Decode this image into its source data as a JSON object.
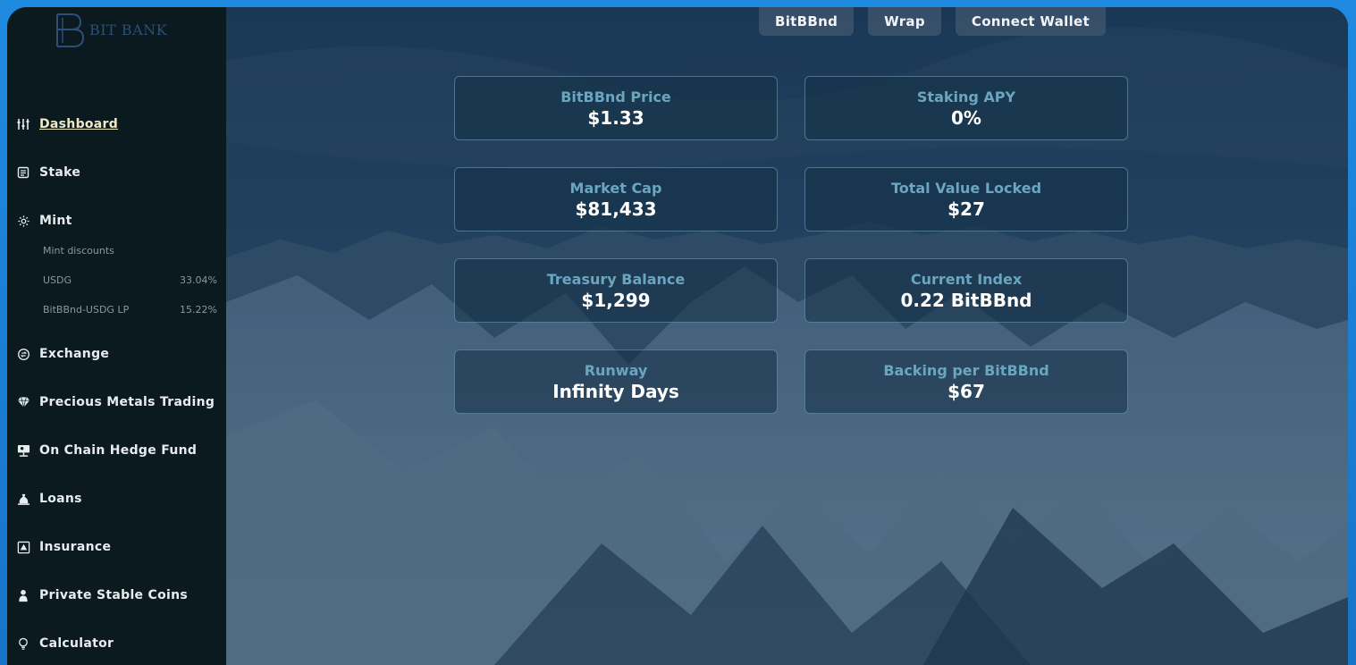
{
  "brand": {
    "logo_letter": "B",
    "logo_text": "BIT BANK"
  },
  "sidebar": {
    "items": [
      {
        "label": "Dashboard",
        "icon": "sliders-icon",
        "active": true
      },
      {
        "label": "Stake",
        "icon": "document-icon"
      },
      {
        "label": "Mint",
        "icon": "gear-icon"
      },
      {
        "label": "Exchange",
        "icon": "exchange-icon"
      },
      {
        "label": "Precious Metals Trading",
        "icon": "diamond-icon"
      },
      {
        "label": "On Chain Hedge Fund",
        "icon": "presentation-icon"
      },
      {
        "label": "Loans",
        "icon": "money-bag-icon"
      },
      {
        "label": "Insurance",
        "icon": "insurance-icon"
      },
      {
        "label": "Private Stable Coins",
        "icon": "person-icon"
      },
      {
        "label": "Calculator",
        "icon": "lightbulb-icon"
      }
    ],
    "mint_submenu": {
      "heading": "Mint discounts",
      "rows": [
        {
          "name": "USDG",
          "value": "33.04%"
        },
        {
          "name": "BitBBnd-USDG LP",
          "value": "15.22%"
        }
      ]
    }
  },
  "topbar": {
    "buttons": [
      {
        "label": "BitBBnd"
      },
      {
        "label": "Wrap"
      },
      {
        "label": "Connect Wallet"
      }
    ]
  },
  "stats": [
    {
      "title": "BitBBnd Price",
      "value": "$1.33"
    },
    {
      "title": "Staking APY",
      "value": "0%"
    },
    {
      "title": "Market Cap",
      "value": "$81,433"
    },
    {
      "title": "Total Value Locked",
      "value": "$27"
    },
    {
      "title": "Treasury Balance",
      "value": "$1,299"
    },
    {
      "title": "Current Index",
      "value": "0.22 BitBBnd"
    },
    {
      "title": "Runway",
      "value": "Infinity Days"
    },
    {
      "title": "Backing per BitBBnd",
      "value": "$67"
    }
  ],
  "colors": {
    "frame": "#1f8be0",
    "sidebar_bg": "#0a1a1e",
    "card_title": "#6aa6bf",
    "card_value": "#ffffff"
  }
}
